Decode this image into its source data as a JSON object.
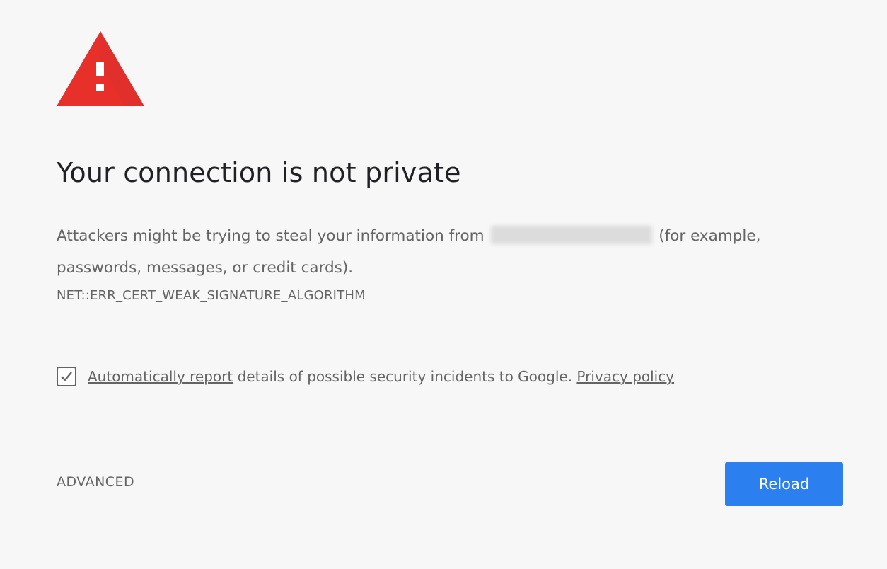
{
  "interstitial": {
    "heading": "Your connection is not private",
    "explanation_before_host": "Attackers might be trying to steal your information from",
    "explanation_after_host": "(for example, passwords, messages, or credit cards).",
    "error_code": "NET::ERR_CERT_WEAK_SIGNATURE_ALGORITHM",
    "icon": "warning-triangle-icon"
  },
  "report": {
    "checked": true,
    "link_label": "Automatically report",
    "text": " details of possible security incidents to Google. ",
    "privacy_link_label": "Privacy policy"
  },
  "actions": {
    "advanced_label": "ADVANCED",
    "reload_label": "Reload"
  },
  "colors": {
    "background": "#f7f7f7",
    "warning_red": "#e8302a",
    "primary_button": "#2b7fef",
    "text_secondary": "#646464",
    "heading_text": "#202124"
  }
}
